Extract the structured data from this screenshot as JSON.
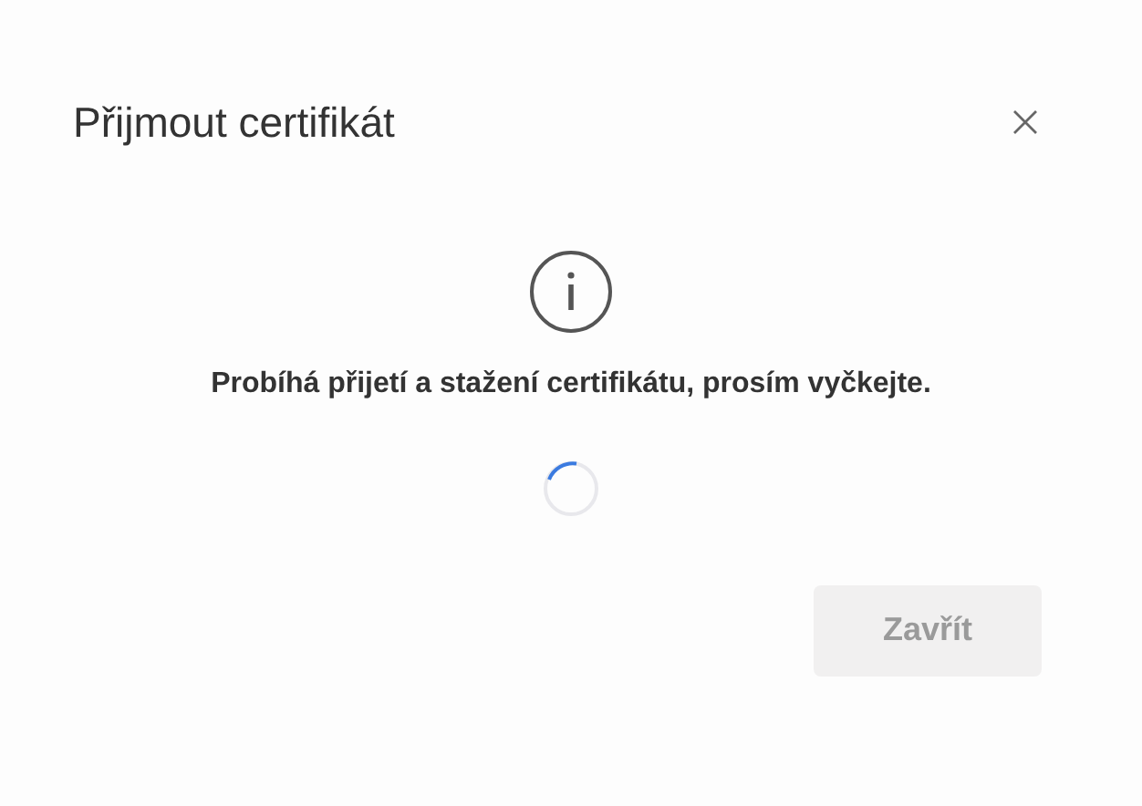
{
  "dialog": {
    "title": "Přijmout certifikát",
    "message": "Probíhá přijetí a stažení certifikátu, prosím vyčkejte.",
    "loading": true,
    "buttons": [
      {
        "label": "Zavřít",
        "disabled": true
      }
    ]
  }
}
